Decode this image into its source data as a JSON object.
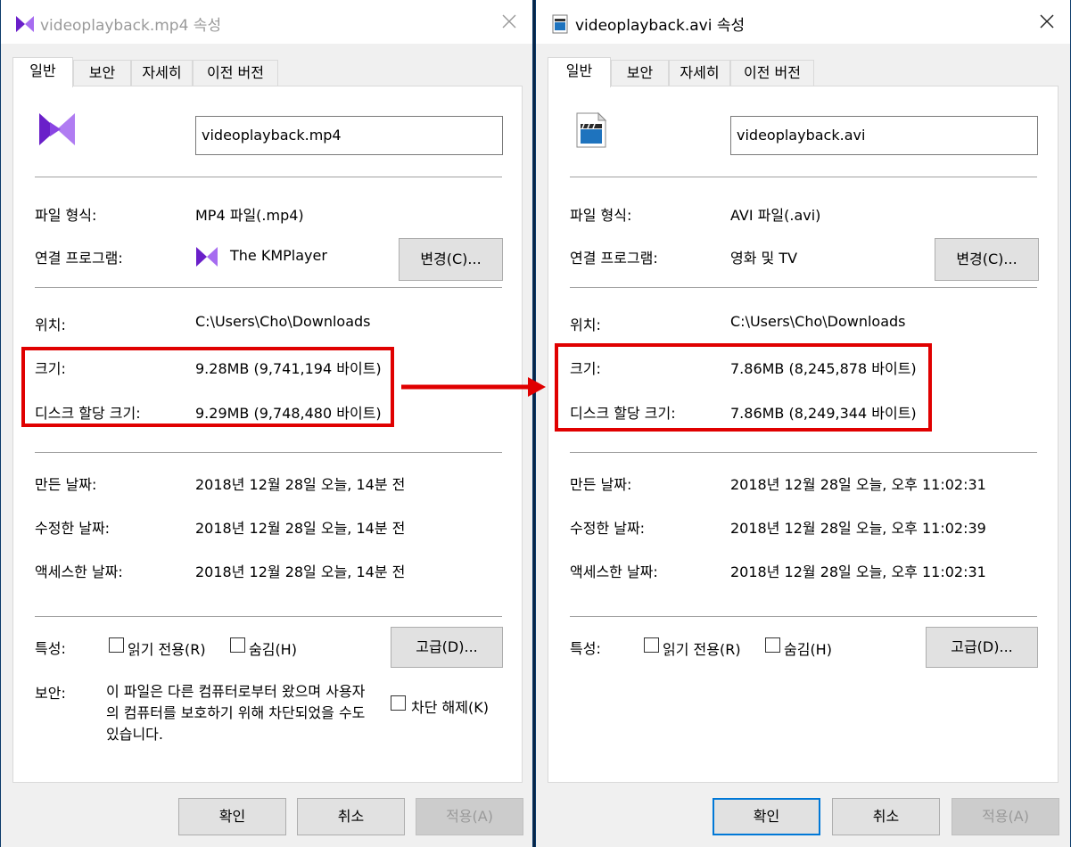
{
  "dialogs": [
    {
      "title": "videoplayback.mp4 속성",
      "tabs": [
        "일반",
        "보안",
        "자세히",
        "이전 버전"
      ],
      "filename": "videoplayback.mp4",
      "file_type_label": "파일 형식:",
      "file_type": "MP4 파일(.mp4)",
      "opens_with_label": "연결 프로그램:",
      "opens_with": "The KMPlayer",
      "change_button": "변경(C)...",
      "location_label": "위치:",
      "location": "C:\\Users\\Cho\\Downloads",
      "size_label": "크기:",
      "size": "9.28MB (9,741,194 바이트)",
      "disk_size_label": "디스크 할당 크기:",
      "disk_size": "9.29MB (9,748,480 바이트)",
      "created_label": "만든 날짜:",
      "created": "2018년 12월 28일 오늘, 14분 전",
      "modified_label": "수정한 날짜:",
      "modified": "2018년 12월 28일 오늘, 14분 전",
      "accessed_label": "액세스한 날짜:",
      "accessed": "2018년 12월 28일 오늘, 14분 전",
      "attributes_label": "특성:",
      "readonly_label": "읽기 전용(R)",
      "hidden_label": "숨김(H)",
      "advanced_button": "고급(D)...",
      "security_label": "보안:",
      "security_note": "이 파일은 다른 컴퓨터로부터 왔으며 사용자의 컴퓨터를 보호하기 위해 차단되었을 수도 있습니다.",
      "unblock_label": "차단 해제(K)",
      "ok": "확인",
      "cancel": "취소",
      "apply": "적용(A)"
    },
    {
      "title": "videoplayback.avi 속성",
      "tabs": [
        "일반",
        "보안",
        "자세히",
        "이전 버전"
      ],
      "filename": "videoplayback.avi",
      "file_type_label": "파일 형식:",
      "file_type": "AVI 파일(.avi)",
      "opens_with_label": "연결 프로그램:",
      "opens_with": "영화 및 TV",
      "change_button": "변경(C)...",
      "location_label": "위치:",
      "location": "C:\\Users\\Cho\\Downloads",
      "size_label": "크기:",
      "size": "7.86MB (8,245,878 바이트)",
      "disk_size_label": "디스크 할당 크기:",
      "disk_size": "7.86MB (8,249,344 바이트)",
      "created_label": "만든 날짜:",
      "created": "2018년 12월 28일 오늘, 오후 11:02:31",
      "modified_label": "수정한 날짜:",
      "modified": "2018년 12월 28일 오늘, 오후 11:02:39",
      "accessed_label": "액세스한 날짜:",
      "accessed": "2018년 12월 28일 오늘, 오후 11:02:31",
      "attributes_label": "특성:",
      "readonly_label": "읽기 전용(R)",
      "hidden_label": "숨김(H)",
      "advanced_button": "고급(D)...",
      "ok": "확인",
      "cancel": "취소",
      "apply": "적용(A)"
    }
  ],
  "colors": {
    "highlight": "#e00000",
    "kmplayer_purple": "#7b2fd6",
    "default_button_border": "#0078d7"
  }
}
